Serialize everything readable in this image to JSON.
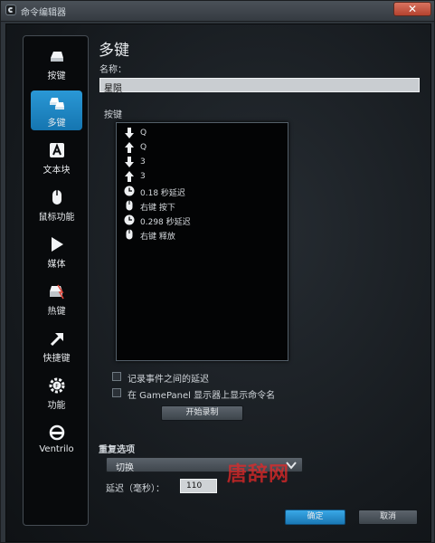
{
  "window": {
    "title": "命令编辑器",
    "close": "✕"
  },
  "sidebar": {
    "items": [
      {
        "label": "按键",
        "icon": "keycap-icon",
        "active": false
      },
      {
        "label": "多键",
        "icon": "multikey-icon",
        "active": true
      },
      {
        "label": "文本块",
        "icon": "text-block-icon",
        "active": false
      },
      {
        "label": "鼠标功能",
        "icon": "mouse-icon",
        "active": false
      },
      {
        "label": "媒体",
        "icon": "media-play-icon",
        "active": false
      },
      {
        "label": "热键",
        "icon": "hotkey-icon",
        "active": false
      },
      {
        "label": "快捷键",
        "icon": "shortcut-arrow-icon",
        "active": false
      },
      {
        "label": "功能",
        "icon": "function-gear-icon",
        "active": false
      },
      {
        "label": "Ventrilo",
        "icon": "headset-icon",
        "active": false
      }
    ]
  },
  "main": {
    "heading": "多键",
    "name_label": "名称：",
    "name_value": "星陨",
    "keys_label": "按键",
    "keys": [
      {
        "icon": "key-down-arrow-icon",
        "text": "Q"
      },
      {
        "icon": "key-up-arrow-icon",
        "text": "Q"
      },
      {
        "icon": "key-down-arrow-icon",
        "text": "3"
      },
      {
        "icon": "key-up-arrow-icon",
        "text": "3"
      },
      {
        "icon": "clock-icon",
        "text": "0.18 秒延迟"
      },
      {
        "icon": "mouse-icon",
        "text": "右键 按下"
      },
      {
        "icon": "clock-icon",
        "text": "0.298 秒延迟"
      },
      {
        "icon": "mouse-icon",
        "text": "右键 释放"
      }
    ],
    "record_delays_label": "记录事件之间的延迟",
    "gamepanel_label": "在 GamePanel 显示器上显示命令名",
    "start_record_label": "开始录制"
  },
  "repeat": {
    "label": "重复选项",
    "mode_value": "切换",
    "delay_label": "延迟（毫秒）：",
    "delay_value": "110"
  },
  "footer": {
    "ok_label": "确定",
    "cancel_label": "取消"
  },
  "watermark": "唐辞网",
  "colors": {
    "accent": "#2a98d6",
    "window_bg": "#2f353b",
    "list_bg": "#030405"
  }
}
